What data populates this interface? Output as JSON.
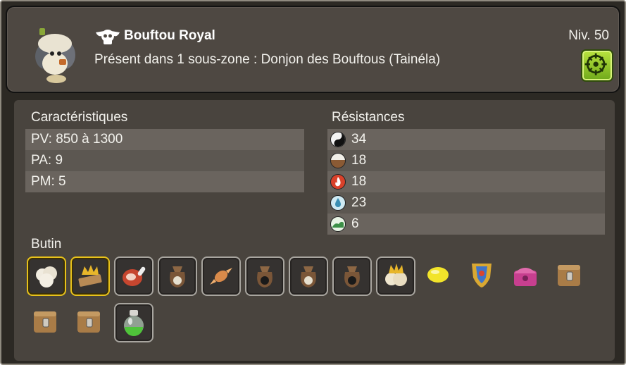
{
  "monster": {
    "name": "Bouftou Royal",
    "level": "Niv. 50",
    "zone_text": "Présent dans 1 sous-zone : Donjon des Bouftous (Tainéla)"
  },
  "characteristics": {
    "title": "Caractéristiques",
    "rows": [
      "PV: 850 à 1300",
      "PA: 9",
      "PM: 5"
    ]
  },
  "resistances": {
    "title": "Résistances",
    "rows": [
      {
        "icon": "neutral-icon",
        "value": "34"
      },
      {
        "icon": "earth-icon",
        "value": "18"
      },
      {
        "icon": "fire-icon",
        "value": "18"
      },
      {
        "icon": "water-icon",
        "value": "23"
      },
      {
        "icon": "air-icon",
        "value": "6"
      }
    ]
  },
  "loot": {
    "title": "Butin",
    "items": [
      {
        "icon": "wool-icon",
        "frame": "gold"
      },
      {
        "icon": "crown-plank-icon",
        "frame": "gold"
      },
      {
        "icon": "meat-icon",
        "frame": "grey"
      },
      {
        "icon": "bag-icon",
        "frame": "grey"
      },
      {
        "icon": "candy-icon",
        "frame": "grey"
      },
      {
        "icon": "bag-dark-icon",
        "frame": "grey"
      },
      {
        "icon": "bag-icon",
        "frame": "grey"
      },
      {
        "icon": "bag-dark-icon",
        "frame": "grey"
      },
      {
        "icon": "crowned-wool-icon",
        "frame": "grey"
      },
      {
        "icon": "lemon-icon",
        "frame": "none"
      },
      {
        "icon": "shield-icon",
        "frame": "none"
      },
      {
        "icon": "pink-chest-icon",
        "frame": "none"
      },
      {
        "icon": "wooden-chest-icon",
        "frame": "none"
      },
      {
        "icon": "wooden-chest-icon",
        "frame": "none"
      },
      {
        "icon": "wooden-chest-icon",
        "frame": "none"
      },
      {
        "icon": "potion-icon",
        "frame": "grey"
      }
    ]
  },
  "colors": {
    "gold_frame": "#e8c21a",
    "compass_green": "#8ccc28"
  }
}
